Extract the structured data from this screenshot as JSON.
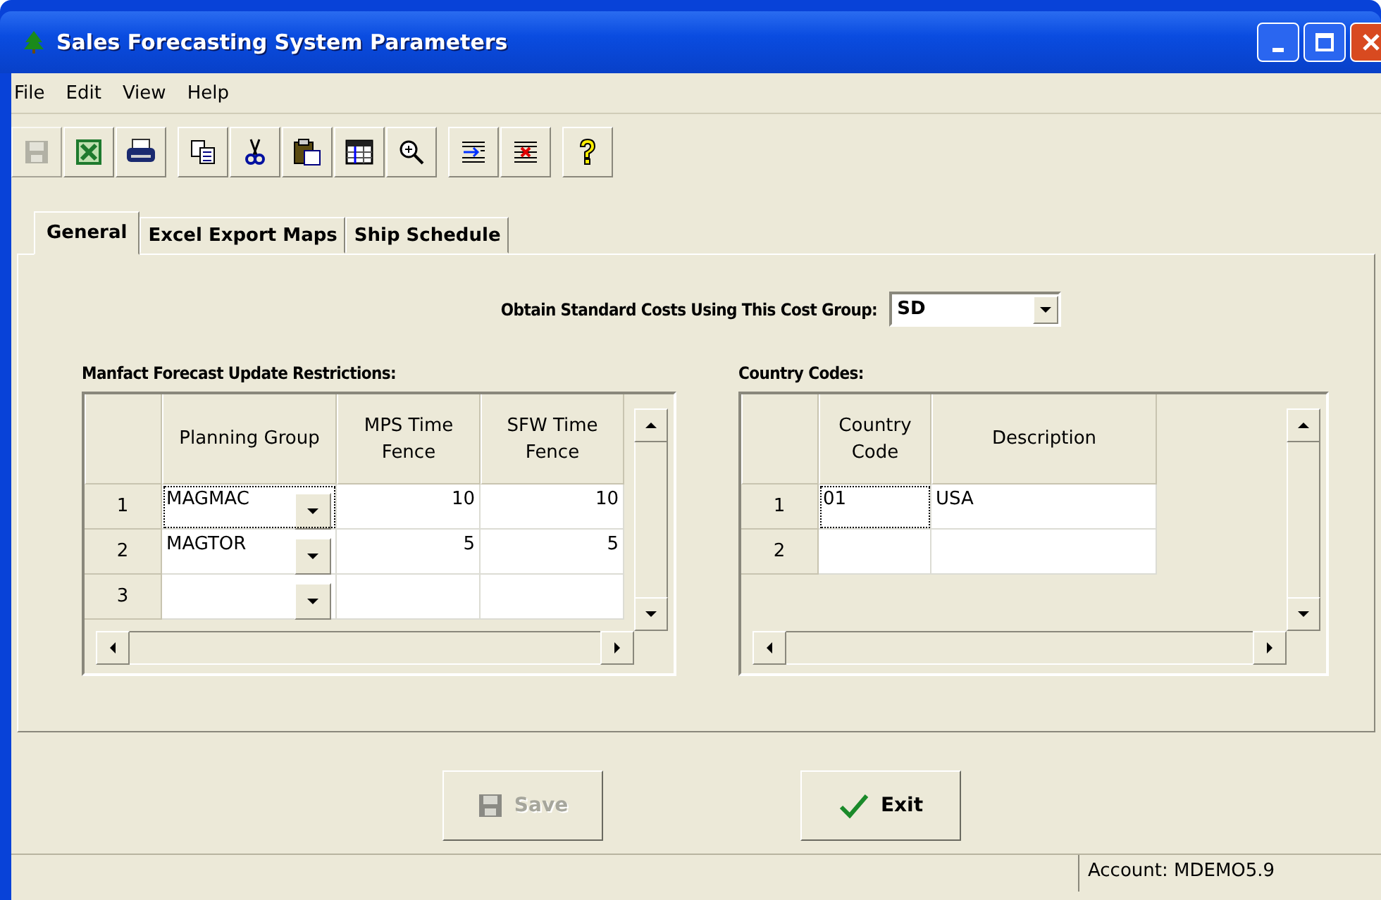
{
  "window": {
    "title": "Sales Forecasting System Parameters"
  },
  "menu": [
    "File",
    "Edit",
    "View",
    "Help"
  ],
  "toolbar": [
    [
      {
        "kind": "save",
        "disabled": true
      },
      {
        "kind": "excel",
        "disabled": false
      },
      {
        "kind": "print",
        "disabled": false
      }
    ],
    [
      {
        "kind": "copy",
        "disabled": false
      },
      {
        "kind": "cut",
        "disabled": false
      },
      {
        "kind": "paste",
        "disabled": false
      },
      {
        "kind": "grid",
        "disabled": false
      },
      {
        "kind": "zoom",
        "disabled": false
      }
    ],
    [
      {
        "kind": "insert-row",
        "disabled": false
      },
      {
        "kind": "delete-row",
        "disabled": false
      }
    ],
    [
      {
        "kind": "help",
        "disabled": false
      }
    ]
  ],
  "tabs": [
    {
      "label": "General",
      "selected": true
    },
    {
      "label": "Excel Export Maps",
      "selected": false
    },
    {
      "label": "Ship Schedule",
      "selected": false
    }
  ],
  "cost_group": {
    "label": "Obtain Standard Costs Using This Cost Group:",
    "value": "SD"
  },
  "grids": [
    {
      "title": "Manfact Forecast Update Restrictions:",
      "columns": [
        {
          "label": "Planning Group",
          "kind": "dropdown"
        },
        {
          "label": "MPS Time Fence",
          "kind": "number"
        },
        {
          "label": "SFW Time Fence",
          "kind": "number"
        }
      ],
      "rows": [
        {
          "number": "1",
          "cells": [
            {
              "value": "MAGMAC",
              "focused": true
            },
            {
              "value": "10",
              "focused": false
            },
            {
              "value": "10",
              "focused": false
            }
          ]
        },
        {
          "number": "2",
          "cells": [
            {
              "value": "MAGTOR",
              "focused": false
            },
            {
              "value": "5",
              "focused": false
            },
            {
              "value": "5",
              "focused": false
            }
          ]
        },
        {
          "number": "3",
          "cells": [
            {
              "focused": false
            },
            {
              "focused": false
            },
            {
              "focused": false
            }
          ]
        }
      ]
    },
    {
      "title": "Country Codes:",
      "columns": [
        {
          "label": "Country Code",
          "kind": "text"
        },
        {
          "label": "Description",
          "kind": "text"
        }
      ],
      "rows": [
        {
          "number": "1",
          "cells": [
            {
              "value": "01",
              "focused": true
            },
            {
              "value": "USA",
              "focused": false
            }
          ]
        },
        {
          "number": "2",
          "cells": [
            {
              "focused": false
            },
            {
              "focused": false
            }
          ]
        }
      ]
    }
  ],
  "buttons": [
    {
      "label": "Save",
      "kind": "save",
      "disabled": true
    },
    {
      "label": "Exit",
      "kind": "exit",
      "disabled": false
    }
  ],
  "status_bar": {
    "account": "Account: MDEMO5.9"
  }
}
